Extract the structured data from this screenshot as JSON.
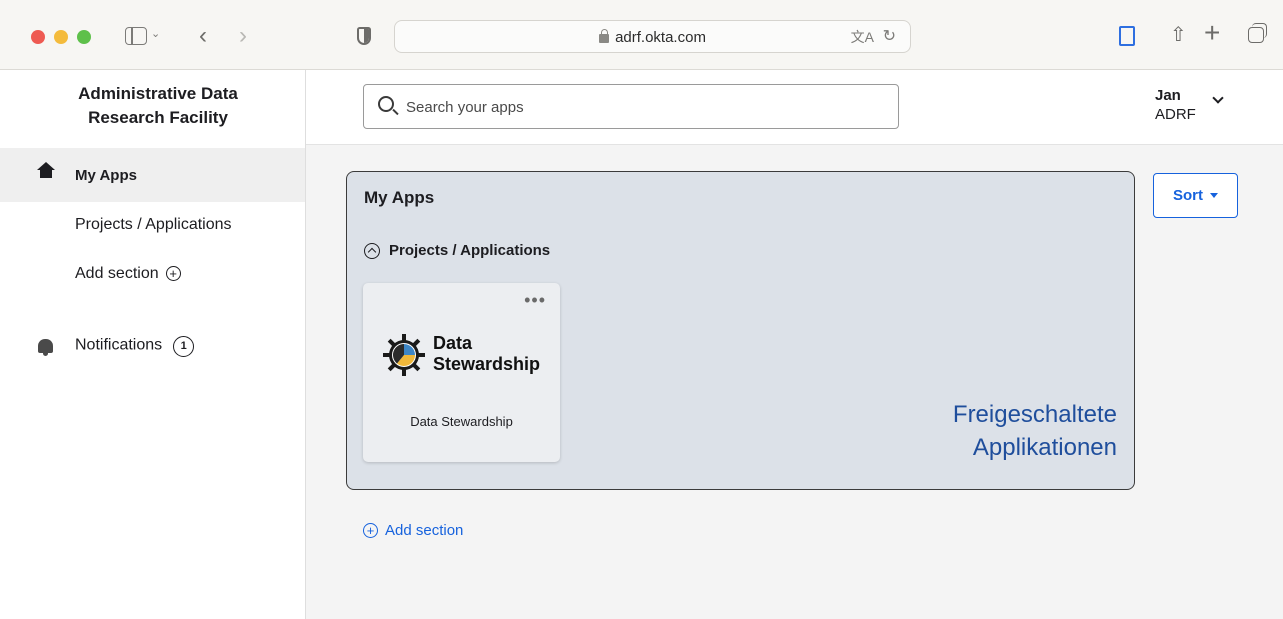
{
  "browser": {
    "url": "adrf.okta.com"
  },
  "sidebar": {
    "brand_line1": "Administrative Data",
    "brand_line2": "Research Facility",
    "items": [
      {
        "label": "My Apps"
      },
      {
        "label": "Projects / Applications"
      },
      {
        "label": "Add section"
      },
      {
        "label": "Notifications",
        "count": "1"
      }
    ]
  },
  "header": {
    "search_placeholder": "Search your apps",
    "user_name": "Jan",
    "user_org": "ADRF"
  },
  "main": {
    "panel_title": "My Apps",
    "section_title": "Projects / Applications",
    "tile": {
      "logo_line1": "Data",
      "logo_line2": "Stewardship",
      "label": "Data Stewardship",
      "menu": "•••"
    },
    "annotation_line1": "Freigeschaltete",
    "annotation_line2": "Applikationen",
    "sort_label": "Sort",
    "add_section_label": "Add section"
  },
  "colors": {
    "accent": "#1662dd",
    "annotation": "#1f4e9c",
    "panel_bg": "#dce1e8"
  }
}
